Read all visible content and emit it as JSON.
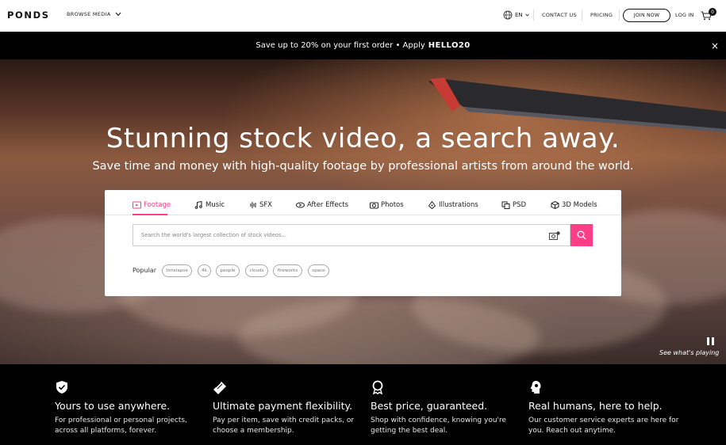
{
  "header": {
    "logo": "PONDS",
    "browse_label": "BROWSE MEDIA",
    "language": "EN",
    "contact_label": "CONTACT US",
    "pricing_label": "PRICING",
    "join_label": "JOIN NOW",
    "login_label": "LOG IN",
    "cart_count": "0"
  },
  "promo": {
    "text": "Save up to 20% on your first order • Apply",
    "code": "HELLO20",
    "close_icon": "×"
  },
  "hero": {
    "title": "Stunning stock video, a search away.",
    "subtitle": "Save time and money with high-quality footage by professional artists from around the world.",
    "see_playing": "See what's playing"
  },
  "search": {
    "tabs": [
      {
        "label": "Footage",
        "icon": "film-icon"
      },
      {
        "label": "Music",
        "icon": "music-note-icon"
      },
      {
        "label": "SFX",
        "icon": "sound-wave-icon"
      },
      {
        "label": "After Effects",
        "icon": "after-effects-icon"
      },
      {
        "label": "Photos",
        "icon": "camera-icon"
      },
      {
        "label": "Illustrations",
        "icon": "pen-nib-icon"
      },
      {
        "label": "PSD",
        "icon": "layers-icon"
      },
      {
        "label": "3D Models",
        "icon": "cube-icon"
      }
    ],
    "placeholder": "Search the world's largest collection of stock videos...",
    "popular_label": "Popular",
    "popular": [
      "timelapse",
      "4k",
      "people",
      "clouds",
      "fireworks",
      "space"
    ]
  },
  "features": [
    {
      "title": "Yours to use anywhere.",
      "text": "For professional or personal projects, across all platforms, forever.",
      "icon": "shield-check-icon"
    },
    {
      "title": "Ultimate payment flexibility.",
      "text": "Pay per item, save with credit packs, or choose a membership.",
      "icon": "credit-card-icon"
    },
    {
      "title": "Best price, guaranteed.",
      "text": "Shop with confidence, knowing you're getting the best deal.",
      "icon": "award-ribbon-icon"
    },
    {
      "title": "Real humans, here to help.",
      "text": "Our customer service experts are here for you. Reach out anytime.",
      "icon": "support-head-icon"
    }
  ],
  "colors": {
    "accent": "#ff3e88",
    "header_bg": "#ffffff",
    "promo_bg": "#000000"
  }
}
